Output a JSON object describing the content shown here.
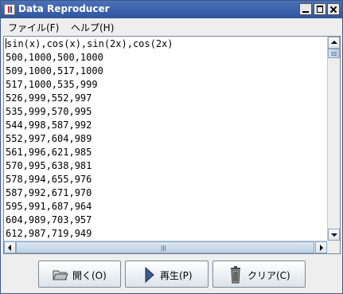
{
  "window": {
    "title": "Data Reproducer"
  },
  "menu": {
    "file": "ファイル(F)",
    "help": "ヘルプ(H)"
  },
  "textarea": {
    "lines": [
      "#sin(x),cos(x),sin(2x),cos(2x)",
      "500,1000,500,1000",
      "509,1000,517,1000",
      "517,1000,535,999",
      "526,999,552,997",
      "535,999,570,995",
      "544,998,587,992",
      "552,997,604,989",
      "561,996,621,985",
      "570,995,638,981",
      "578,994,655,976",
      "587,992,671,970",
      "595,991,687,964",
      "604,989,703,957",
      "612,987,719,949"
    ]
  },
  "buttons": {
    "open": "開く(O)",
    "play": "再生(P)",
    "clear": "クリア(C)"
  },
  "icons": {
    "open": "folder-open-icon",
    "play": "play-icon",
    "clear": "trash-icon"
  }
}
